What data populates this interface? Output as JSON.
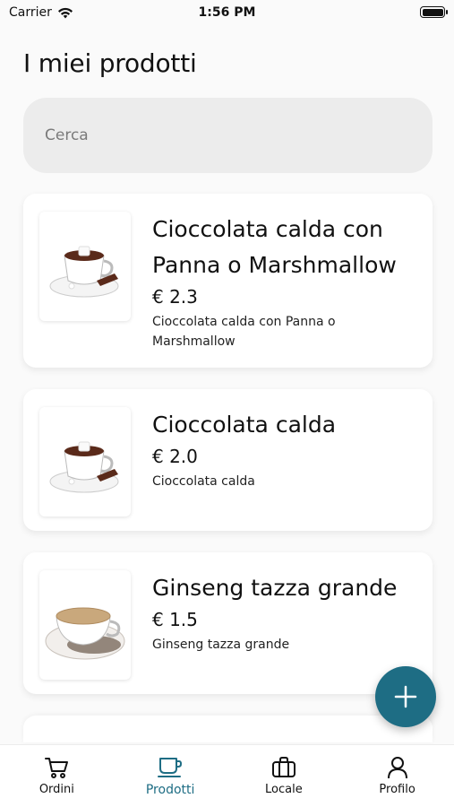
{
  "status": {
    "carrier": "Carrier",
    "time": "1:56 PM"
  },
  "title": "I miei prodotti",
  "search": {
    "placeholder": "Cerca",
    "value": ""
  },
  "products": [
    {
      "name": "Cioccolata calda con Panna o Marshmallow",
      "price": "€ 2.3",
      "description": "Cioccolata calda con Panna o Marshmallow",
      "image": "hot-chocolate"
    },
    {
      "name": "Cioccolata calda",
      "price": "€ 2.0",
      "description": "Cioccolata calda",
      "image": "hot-chocolate"
    },
    {
      "name": "Ginseng tazza grande",
      "price": "€ 1.5",
      "description": "Ginseng tazza grande",
      "image": "ginseng-cup"
    }
  ],
  "fab": {
    "icon": "plus-icon"
  },
  "tabs": [
    {
      "label": "Ordini",
      "icon": "cart-icon",
      "active": false
    },
    {
      "label": "Prodotti",
      "icon": "coffee-cup-icon",
      "active": true
    },
    {
      "label": "Locale",
      "icon": "briefcase-icon",
      "active": false
    },
    {
      "label": "Profilo",
      "icon": "user-icon",
      "active": false
    }
  ],
  "colors": {
    "accent": "#1e6d84",
    "search_bg": "#ececec",
    "background": "#fafafa"
  }
}
